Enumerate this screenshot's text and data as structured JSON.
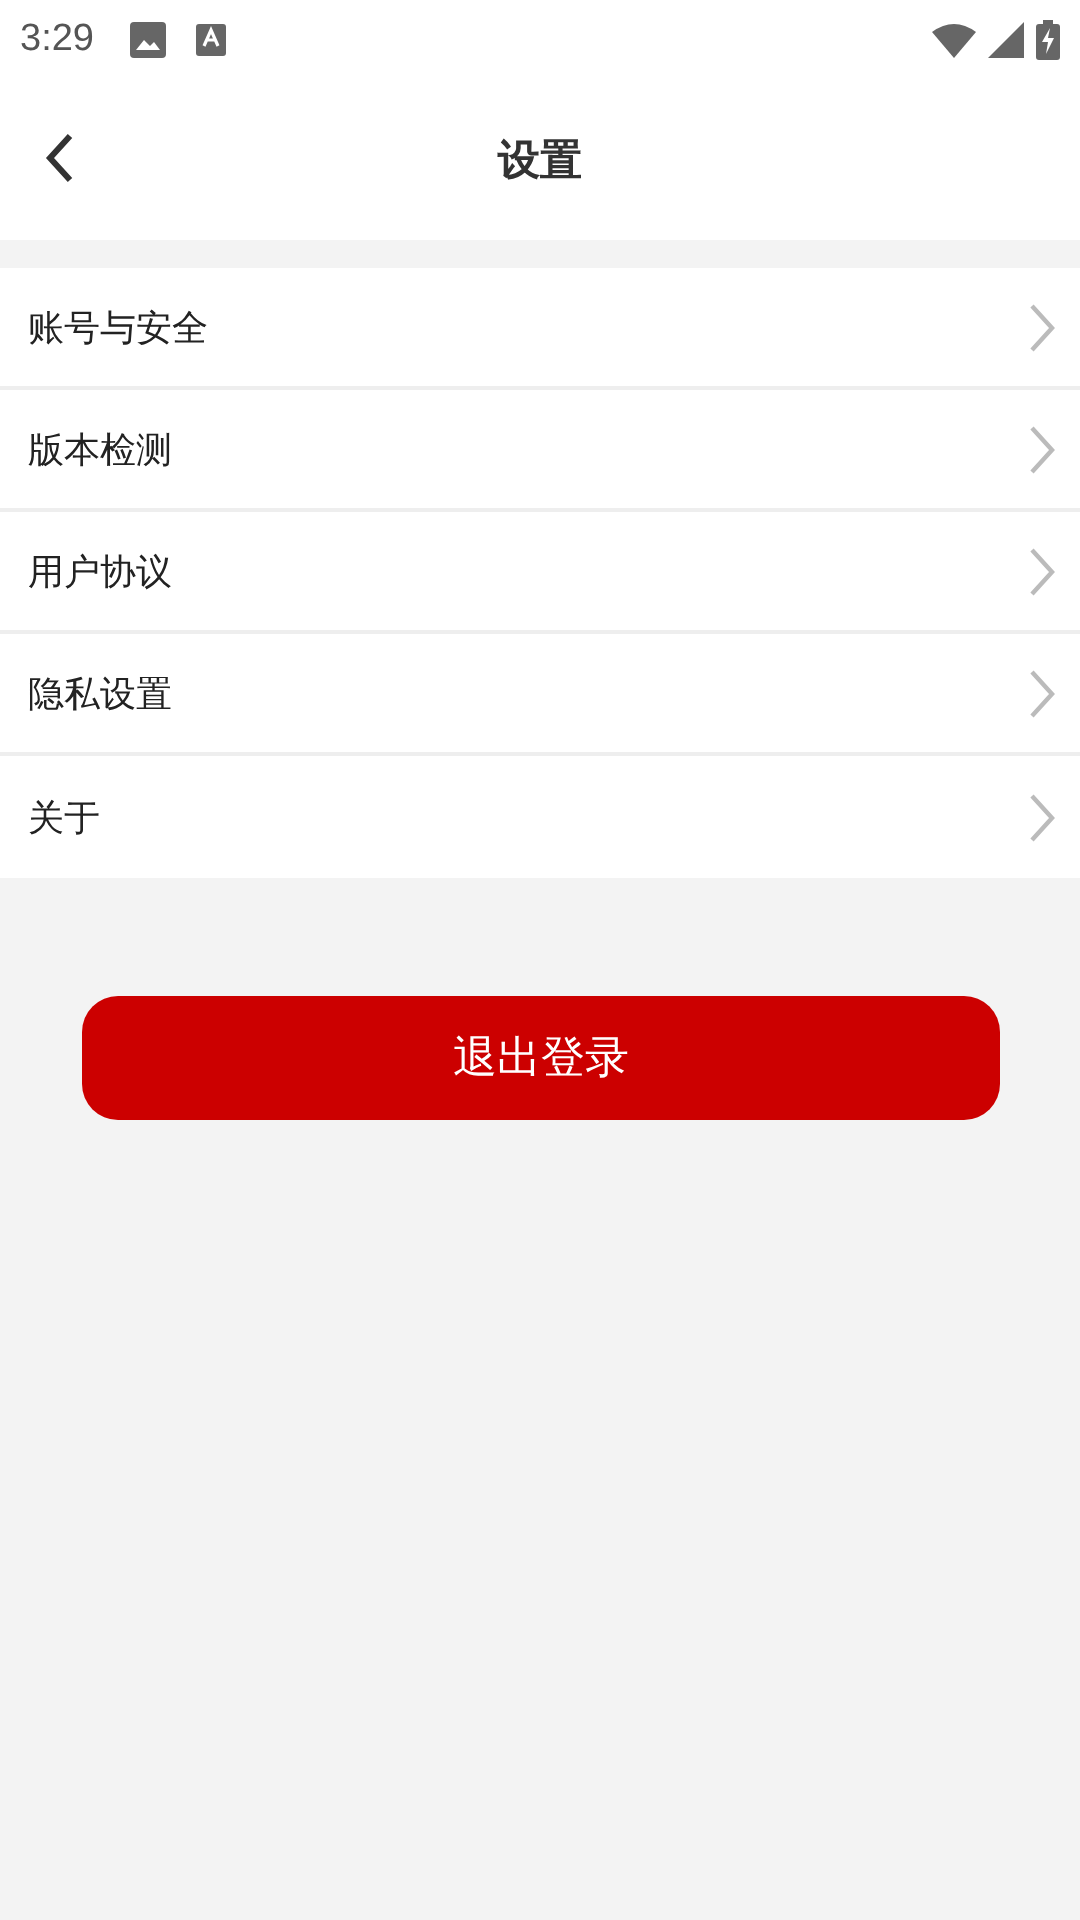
{
  "status_bar": {
    "time": "3:29"
  },
  "header": {
    "title": "设置"
  },
  "menu_items": [
    {
      "label": "账号与安全"
    },
    {
      "label": "版本检测"
    },
    {
      "label": "用户协议"
    },
    {
      "label": "隐私设置"
    },
    {
      "label": "关于"
    }
  ],
  "logout_button": {
    "label": "退出登录"
  }
}
